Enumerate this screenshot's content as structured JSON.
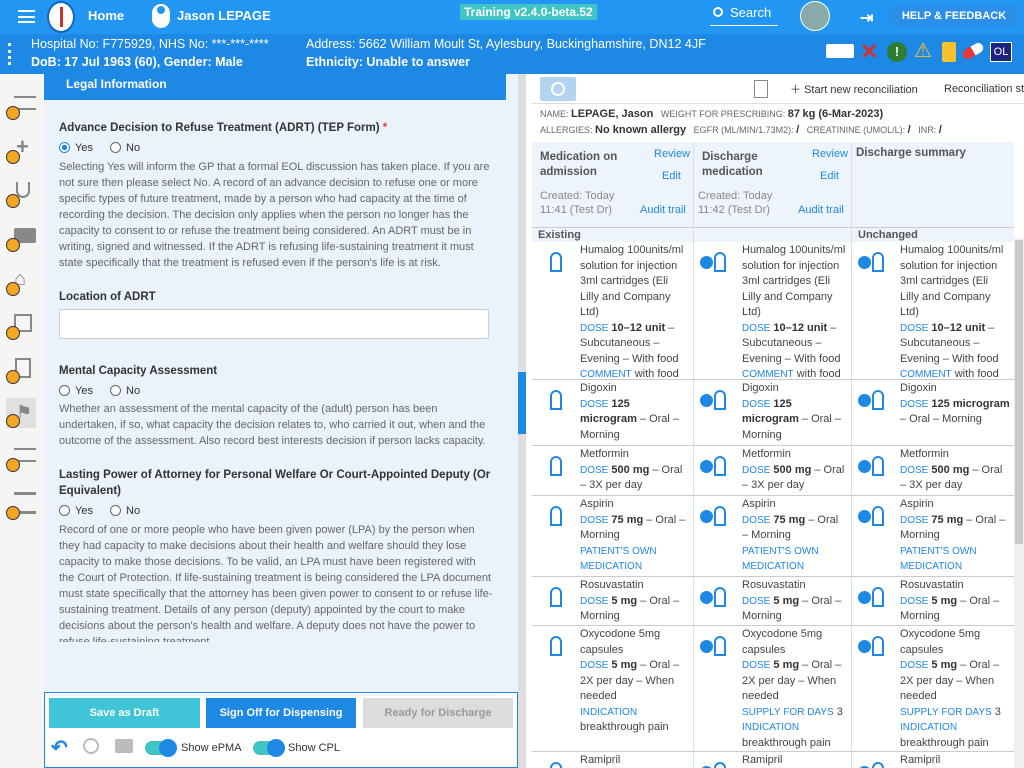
{
  "topbar": {
    "home": "Home",
    "patient_name": "Jason LEPAGE",
    "version": "Training v2.4.0-beta.52",
    "search": "Search",
    "help": "HELP & FEEDBACK"
  },
  "banner": {
    "hospital": "Hospital No: F775929, NHS No: ***-***-****",
    "dob": "DoB: 17 Jul 1963 (60), Gender: Male",
    "address": "Address: 5662 William Moult St, Aylesbury, Buckinghamshire, DN12 4JF",
    "ethnicity": "Ethnicity: Unable to answer",
    "avatar": "OL"
  },
  "legal": {
    "header": "Legal Information",
    "adrt_q": "Advance Decision to Refuse Treatment (ADRT) (TEP Form)",
    "req": "*",
    "yes": "Yes",
    "no": "No",
    "adrt_help": "Selecting Yes will inform the GP that a formal EOL discussion has taken place. If you are not sure then please select No. A record of an advance decision to refuse one or more specific types of future treatment, made by a person who had capacity at the time of recording the decision. The decision only applies when the person no longer has the capacity to consent to or refuse the treatment being considered. An ADRT must be in writing, signed and witnessed. If the ADRT is refusing life-sustaining treatment it must state specifically that the treatment is refused even if the person's life is at risk.",
    "loc_q": "Location of ADRT",
    "mca_q": "Mental Capacity Assessment",
    "mca_help": "Whether an assessment of the mental capacity of the (adult) person has been undertaken, if so, what capacity the decision relates to, who carried it out, when and the outcome of the assessment. Also record best interests decision if person lacks capacity.",
    "lpa_q": "Lasting Power of Attorney for Personal Welfare Or Court-Appointed Deputy (Or Equivalent)",
    "lpa_help": "Record of one or more people who have been given power (LPA) by the person when they had capacity to make decisions about their health and welfare should they lose capacity to make those decisions. To be valid, an LPA must have been registered with the Court of Protection. If life-sustaining treatment is being considered the LPA document must state specifically that the attorney has been given power to consent to or refuse life-sustaining treatment. Details of any person (deputy) appointed by the court to make decisions about the person's health and welfare. A deputy does not have the power to refuse life-sustaining treatment."
  },
  "bottom": {
    "draft": "Save as Draft",
    "signoff": "Sign Off for Dispensing",
    "ready": "Ready for Discharge",
    "show_epma": "Show ePMA",
    "show_cpl": "Show CPL"
  },
  "recon": {
    "start": "Start new reconciliation",
    "status": "Reconciliation st",
    "name_lbl": "NAME:",
    "name": "LEPAGE, Jason",
    "weight_lbl": "WEIGHT FOR PRESCRIBING:",
    "weight": "87",
    "weight_unit": "kg (6-Mar-2023)",
    "allergy_lbl": "ALLERGIES:",
    "allergy": "No known allergy",
    "egfr_lbl": "EGFR (ML/MIN/1.73M2):",
    "egfr": "/",
    "creat_lbl": "CREATININE (UMOL/L):",
    "creat": "/",
    "inr_lbl": "INR:",
    "inr": "/",
    "col1": {
      "title": "Medication on admission",
      "review": "Review",
      "edit": "Edit",
      "created": "Created: Today",
      "time": "11:41 (Test Dr)",
      "audit": "Audit trail",
      "section": "Existing"
    },
    "col2": {
      "title": "Discharge medication",
      "review": "Review",
      "edit": "Edit",
      "created": "Created: Today",
      "time": "11:42 (Test Dr)",
      "audit": "Audit trail"
    },
    "col3": {
      "title": "Discharge summary",
      "section": "Unchanged"
    }
  },
  "meds": [
    {
      "name": "Humalog 100units/ml solution for injection 3ml cartridges (Eli Lilly and Company Ltd)",
      "dose_kw": "DOSE",
      "dose": "10–12 unit",
      "route": " – Subcutaneous – Evening – With food",
      "extra_kw": "COMMENT",
      "extra": " with food"
    },
    {
      "name": "Digoxin",
      "dose_kw": "DOSE",
      "dose": "125 microgram",
      "route": " – Oral – Morning"
    },
    {
      "name": "Metformin",
      "dose_kw": "DOSE",
      "dose": "500 mg",
      "route": " – Oral – 3X per day"
    },
    {
      "name": "Aspirin",
      "dose_kw": "DOSE",
      "dose": "75 mg",
      "route": " – Oral – Morning",
      "extra_kw": "PATIENT'S OWN MEDICATION"
    },
    {
      "name": "Rosuvastatin",
      "dose_kw": "DOSE",
      "dose": "5 mg",
      "route": " – Oral – Morning"
    },
    {
      "name": "Oxycodone 5mg capsules",
      "dose_kw": "DOSE",
      "dose": "5 mg",
      "route": " – Oral – 2X per day – When needed",
      "extra_kw": "INDICATION",
      "extra": "breakthrough pain",
      "supply_kw": "SUPPLY FOR DAYS",
      "supply": "3"
    },
    {
      "name": "Ramipril"
    }
  ]
}
